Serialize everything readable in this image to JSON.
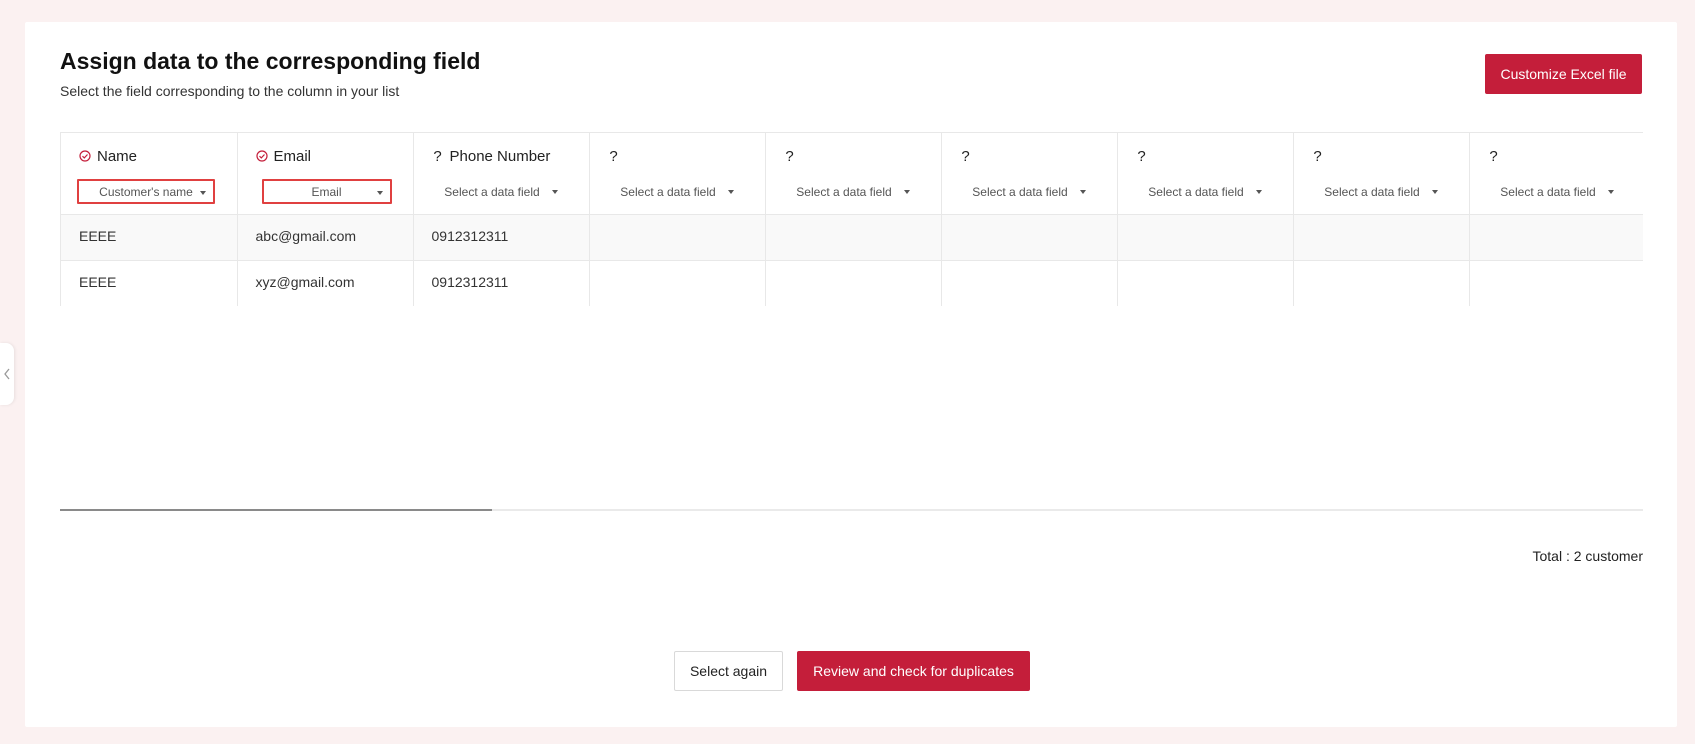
{
  "header": {
    "title": "Assign data to the corresponding field",
    "subtitle": "Select the field corresponding to the column in your list",
    "customize_button": "Customize Excel file"
  },
  "columns": [
    {
      "header": "Name",
      "status_icon": "check-circle-icon",
      "select_value": "Customer's name",
      "highlighted": true
    },
    {
      "header": "Email",
      "status_icon": "check-circle-icon",
      "select_value": "Email",
      "highlighted": true
    },
    {
      "header": "Phone Number",
      "status_icon": "question-icon",
      "select_value": "Select a data field",
      "highlighted": false
    },
    {
      "header": "",
      "status_icon": "question-icon",
      "select_value": "Select a data field",
      "highlighted": false
    },
    {
      "header": "",
      "status_icon": "question-icon",
      "select_value": "Select a data field",
      "highlighted": false
    },
    {
      "header": "",
      "status_icon": "question-icon",
      "select_value": "Select a data field",
      "highlighted": false
    },
    {
      "header": "",
      "status_icon": "question-icon",
      "select_value": "Select a data field",
      "highlighted": false
    },
    {
      "header": "",
      "status_icon": "question-icon",
      "select_value": "Select a data field",
      "highlighted": false
    },
    {
      "header": "",
      "status_icon": "question-icon",
      "select_value": "Select a data field",
      "highlighted": false
    },
    {
      "header": "",
      "status_icon": "question-icon",
      "select_value": "Select a data field",
      "highlighted": false
    }
  ],
  "icons": {
    "question": "?"
  },
  "rows": [
    [
      "EEEE",
      "abc@gmail.com",
      "0912312311",
      "",
      "",
      "",
      "",
      "",
      "",
      ""
    ],
    [
      "EEEE",
      "xyz@gmail.com",
      "0912312311",
      "",
      "",
      "",
      "",
      "",
      "",
      ""
    ]
  ],
  "footer": {
    "total": "Total : 2 customer",
    "select_again": "Select again",
    "review_button": "Review and check for duplicates"
  },
  "colors": {
    "accent": "#c41e3a",
    "highlight_border": "#e04040"
  }
}
